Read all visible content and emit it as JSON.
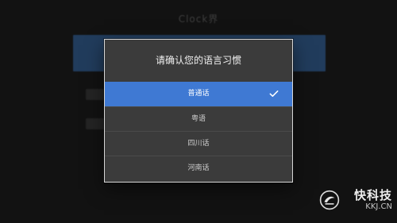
{
  "background": {
    "title": "Clock界"
  },
  "dialog": {
    "title": "请确认您的语言习惯",
    "options": [
      {
        "label": "普通话",
        "selected": true
      },
      {
        "label": "粤语",
        "selected": false
      },
      {
        "label": "四川话",
        "selected": false
      },
      {
        "label": "河南话",
        "selected": false
      }
    ],
    "icons": {
      "selected_marker": "check-icon"
    }
  },
  "watermark": {
    "brand": "快科技",
    "site": "KKJ.CN"
  },
  "colors": {
    "selected": "#3f79d3",
    "dialog_bg": "#3b3b3b",
    "page_bg": "#121212"
  }
}
